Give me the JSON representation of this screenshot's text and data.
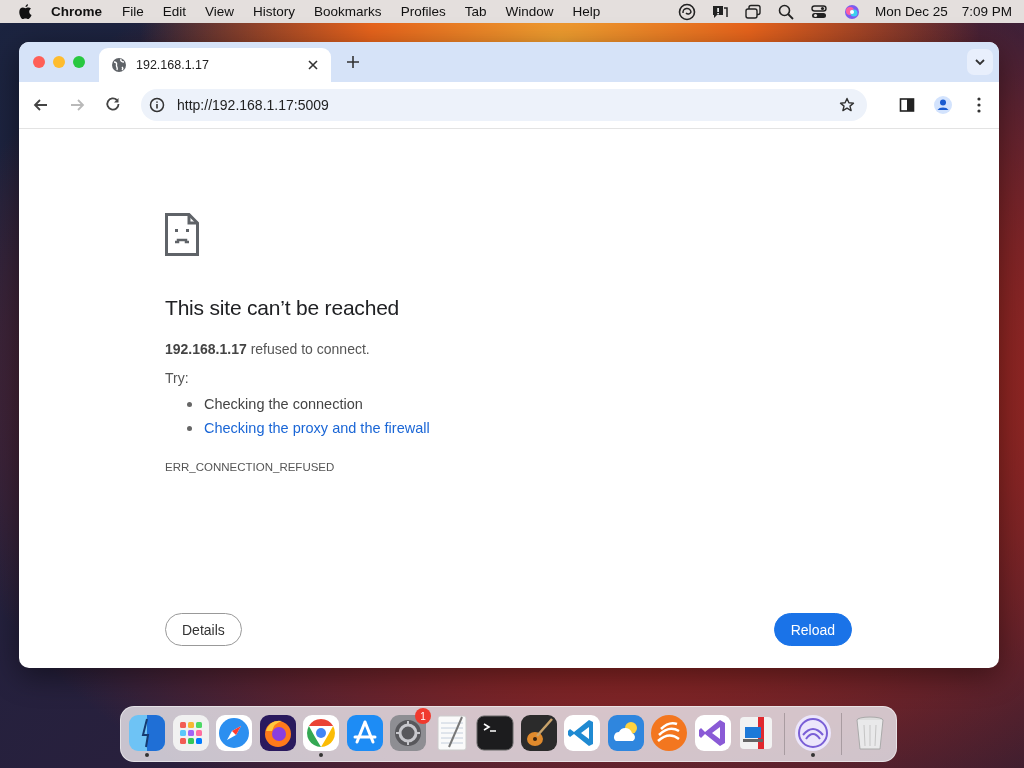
{
  "menu_bar": {
    "app_name": "Chrome",
    "menus": [
      "File",
      "Edit",
      "View",
      "History",
      "Bookmarks",
      "Profiles",
      "Tab",
      "Window",
      "Help"
    ],
    "date": "Mon Dec 25",
    "time": "7:09 PM"
  },
  "browser": {
    "tabs": [
      {
        "title": "192.168.1.17",
        "selected": true
      }
    ],
    "nav": {
      "back_enabled": true,
      "forward_enabled": false
    },
    "address": "http://192.168.1.17:5009"
  },
  "error_page": {
    "heading": "This site can’t be reached",
    "message": "**192.168.1.17** refused to connect.",
    "try_label": "Try:",
    "suggestions": [
      {
        "text": "Checking the connection",
        "kind": "text"
      },
      {
        "text": "Checking the proxy and the firewall",
        "kind": "link"
      }
    ],
    "error_code": "ERR_CONNECTION_REFUSED",
    "buttons": [
      {
        "label": "Details",
        "kind": "secondary"
      },
      {
        "label": "Reload",
        "kind": "primary"
      }
    ]
  },
  "dock": {
    "sections": [
      [
        {
          "kind": "finder",
          "running": true
        },
        {
          "kind": "launchpad",
          "running": false
        },
        {
          "kind": "safari",
          "running": false
        },
        {
          "kind": "firefox",
          "running": false
        },
        {
          "kind": "chrome",
          "running": true
        },
        {
          "kind": "appstore",
          "running": false
        },
        {
          "kind": "settings",
          "running": false,
          "badge": "1"
        },
        {
          "kind": "textedit",
          "running": false
        },
        {
          "kind": "terminal",
          "running": false
        },
        {
          "kind": "guitar",
          "running": false
        },
        {
          "kind": "vscode",
          "running": false
        },
        {
          "kind": "weather",
          "running": false
        },
        {
          "kind": "swoosh",
          "running": false
        },
        {
          "kind": "vstudio",
          "running": false
        },
        {
          "kind": "remote",
          "running": false
        }
      ],
      [
        {
          "kind": "torrent",
          "running": true
        }
      ],
      [
        {
          "kind": "trash",
          "running": false
        }
      ]
    ]
  }
}
